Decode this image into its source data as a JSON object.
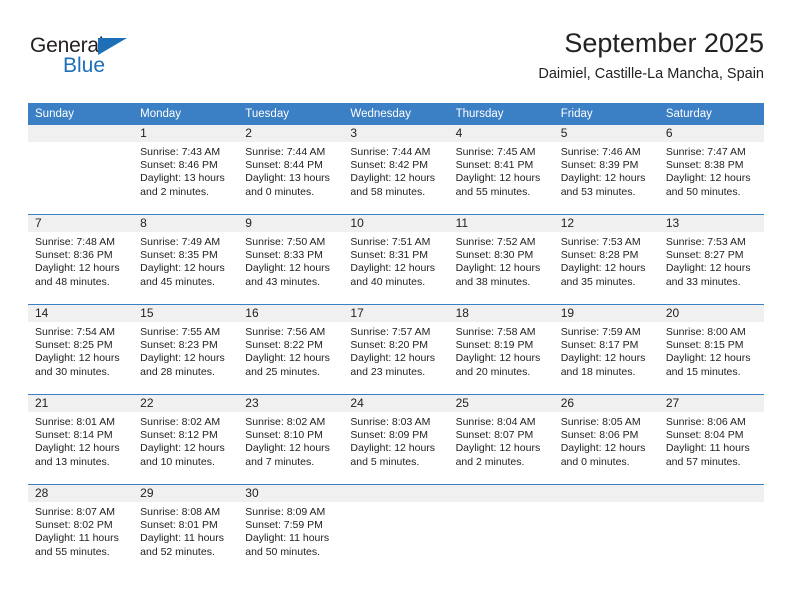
{
  "logo": {
    "word1": "General",
    "word2": "Blue",
    "triangle_color": "#1d6fb8",
    "word1_color": "#231f20",
    "word2_color": "#1d6fb8"
  },
  "header": {
    "title": "September 2025",
    "subtitle": "Daimiel, Castille-La Mancha, Spain"
  },
  "theme": {
    "header_bg": "#3b7fc4",
    "header_text": "#ffffff",
    "daynum_bg": "#f0f0f0",
    "body_text": "#222222",
    "row_divider": "#3b7fc4"
  },
  "weekday_headers": [
    "Sunday",
    "Monday",
    "Tuesday",
    "Wednesday",
    "Thursday",
    "Friday",
    "Saturday"
  ],
  "weeks": [
    [
      {
        "day": "",
        "sunrise": "",
        "sunset": "",
        "daylight_line1": "",
        "daylight_line2": ""
      },
      {
        "day": "1",
        "sunrise": "Sunrise: 7:43 AM",
        "sunset": "Sunset: 8:46 PM",
        "daylight_line1": "Daylight: 13 hours",
        "daylight_line2": "and 2 minutes."
      },
      {
        "day": "2",
        "sunrise": "Sunrise: 7:44 AM",
        "sunset": "Sunset: 8:44 PM",
        "daylight_line1": "Daylight: 13 hours",
        "daylight_line2": "and 0 minutes."
      },
      {
        "day": "3",
        "sunrise": "Sunrise: 7:44 AM",
        "sunset": "Sunset: 8:42 PM",
        "daylight_line1": "Daylight: 12 hours",
        "daylight_line2": "and 58 minutes."
      },
      {
        "day": "4",
        "sunrise": "Sunrise: 7:45 AM",
        "sunset": "Sunset: 8:41 PM",
        "daylight_line1": "Daylight: 12 hours",
        "daylight_line2": "and 55 minutes."
      },
      {
        "day": "5",
        "sunrise": "Sunrise: 7:46 AM",
        "sunset": "Sunset: 8:39 PM",
        "daylight_line1": "Daylight: 12 hours",
        "daylight_line2": "and 53 minutes."
      },
      {
        "day": "6",
        "sunrise": "Sunrise: 7:47 AM",
        "sunset": "Sunset: 8:38 PM",
        "daylight_line1": "Daylight: 12 hours",
        "daylight_line2": "and 50 minutes."
      }
    ],
    [
      {
        "day": "7",
        "sunrise": "Sunrise: 7:48 AM",
        "sunset": "Sunset: 8:36 PM",
        "daylight_line1": "Daylight: 12 hours",
        "daylight_line2": "and 48 minutes."
      },
      {
        "day": "8",
        "sunrise": "Sunrise: 7:49 AM",
        "sunset": "Sunset: 8:35 PM",
        "daylight_line1": "Daylight: 12 hours",
        "daylight_line2": "and 45 minutes."
      },
      {
        "day": "9",
        "sunrise": "Sunrise: 7:50 AM",
        "sunset": "Sunset: 8:33 PM",
        "daylight_line1": "Daylight: 12 hours",
        "daylight_line2": "and 43 minutes."
      },
      {
        "day": "10",
        "sunrise": "Sunrise: 7:51 AM",
        "sunset": "Sunset: 8:31 PM",
        "daylight_line1": "Daylight: 12 hours",
        "daylight_line2": "and 40 minutes."
      },
      {
        "day": "11",
        "sunrise": "Sunrise: 7:52 AM",
        "sunset": "Sunset: 8:30 PM",
        "daylight_line1": "Daylight: 12 hours",
        "daylight_line2": "and 38 minutes."
      },
      {
        "day": "12",
        "sunrise": "Sunrise: 7:53 AM",
        "sunset": "Sunset: 8:28 PM",
        "daylight_line1": "Daylight: 12 hours",
        "daylight_line2": "and 35 minutes."
      },
      {
        "day": "13",
        "sunrise": "Sunrise: 7:53 AM",
        "sunset": "Sunset: 8:27 PM",
        "daylight_line1": "Daylight: 12 hours",
        "daylight_line2": "and 33 minutes."
      }
    ],
    [
      {
        "day": "14",
        "sunrise": "Sunrise: 7:54 AM",
        "sunset": "Sunset: 8:25 PM",
        "daylight_line1": "Daylight: 12 hours",
        "daylight_line2": "and 30 minutes."
      },
      {
        "day": "15",
        "sunrise": "Sunrise: 7:55 AM",
        "sunset": "Sunset: 8:23 PM",
        "daylight_line1": "Daylight: 12 hours",
        "daylight_line2": "and 28 minutes."
      },
      {
        "day": "16",
        "sunrise": "Sunrise: 7:56 AM",
        "sunset": "Sunset: 8:22 PM",
        "daylight_line1": "Daylight: 12 hours",
        "daylight_line2": "and 25 minutes."
      },
      {
        "day": "17",
        "sunrise": "Sunrise: 7:57 AM",
        "sunset": "Sunset: 8:20 PM",
        "daylight_line1": "Daylight: 12 hours",
        "daylight_line2": "and 23 minutes."
      },
      {
        "day": "18",
        "sunrise": "Sunrise: 7:58 AM",
        "sunset": "Sunset: 8:19 PM",
        "daylight_line1": "Daylight: 12 hours",
        "daylight_line2": "and 20 minutes."
      },
      {
        "day": "19",
        "sunrise": "Sunrise: 7:59 AM",
        "sunset": "Sunset: 8:17 PM",
        "daylight_line1": "Daylight: 12 hours",
        "daylight_line2": "and 18 minutes."
      },
      {
        "day": "20",
        "sunrise": "Sunrise: 8:00 AM",
        "sunset": "Sunset: 8:15 PM",
        "daylight_line1": "Daylight: 12 hours",
        "daylight_line2": "and 15 minutes."
      }
    ],
    [
      {
        "day": "21",
        "sunrise": "Sunrise: 8:01 AM",
        "sunset": "Sunset: 8:14 PM",
        "daylight_line1": "Daylight: 12 hours",
        "daylight_line2": "and 13 minutes."
      },
      {
        "day": "22",
        "sunrise": "Sunrise: 8:02 AM",
        "sunset": "Sunset: 8:12 PM",
        "daylight_line1": "Daylight: 12 hours",
        "daylight_line2": "and 10 minutes."
      },
      {
        "day": "23",
        "sunrise": "Sunrise: 8:02 AM",
        "sunset": "Sunset: 8:10 PM",
        "daylight_line1": "Daylight: 12 hours",
        "daylight_line2": "and 7 minutes."
      },
      {
        "day": "24",
        "sunrise": "Sunrise: 8:03 AM",
        "sunset": "Sunset: 8:09 PM",
        "daylight_line1": "Daylight: 12 hours",
        "daylight_line2": "and 5 minutes."
      },
      {
        "day": "25",
        "sunrise": "Sunrise: 8:04 AM",
        "sunset": "Sunset: 8:07 PM",
        "daylight_line1": "Daylight: 12 hours",
        "daylight_line2": "and 2 minutes."
      },
      {
        "day": "26",
        "sunrise": "Sunrise: 8:05 AM",
        "sunset": "Sunset: 8:06 PM",
        "daylight_line1": "Daylight: 12 hours",
        "daylight_line2": "and 0 minutes."
      },
      {
        "day": "27",
        "sunrise": "Sunrise: 8:06 AM",
        "sunset": "Sunset: 8:04 PM",
        "daylight_line1": "Daylight: 11 hours",
        "daylight_line2": "and 57 minutes."
      }
    ],
    [
      {
        "day": "28",
        "sunrise": "Sunrise: 8:07 AM",
        "sunset": "Sunset: 8:02 PM",
        "daylight_line1": "Daylight: 11 hours",
        "daylight_line2": "and 55 minutes."
      },
      {
        "day": "29",
        "sunrise": "Sunrise: 8:08 AM",
        "sunset": "Sunset: 8:01 PM",
        "daylight_line1": "Daylight: 11 hours",
        "daylight_line2": "and 52 minutes."
      },
      {
        "day": "30",
        "sunrise": "Sunrise: 8:09 AM",
        "sunset": "Sunset: 7:59 PM",
        "daylight_line1": "Daylight: 11 hours",
        "daylight_line2": "and 50 minutes."
      },
      {
        "day": "",
        "sunrise": "",
        "sunset": "",
        "daylight_line1": "",
        "daylight_line2": ""
      },
      {
        "day": "",
        "sunrise": "",
        "sunset": "",
        "daylight_line1": "",
        "daylight_line2": ""
      },
      {
        "day": "",
        "sunrise": "",
        "sunset": "",
        "daylight_line1": "",
        "daylight_line2": ""
      },
      {
        "day": "",
        "sunrise": "",
        "sunset": "",
        "daylight_line1": "",
        "daylight_line2": ""
      }
    ]
  ]
}
